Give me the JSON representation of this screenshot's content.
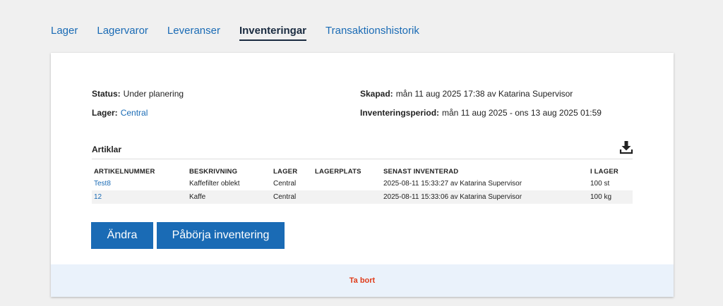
{
  "tabs": [
    {
      "label": "Lager"
    },
    {
      "label": "Lagervaror"
    },
    {
      "label": "Leveranser"
    },
    {
      "label": "Inventeringar"
    },
    {
      "label": "Transaktionshistorik"
    }
  ],
  "meta": {
    "status_label": "Status:",
    "status_value": "Under planering",
    "lager_label": "Lager:",
    "lager_value": "Central",
    "skapad_label": "Skapad:",
    "skapad_value": "mån 11 aug 2025 17:38 av Katarina Supervisor",
    "period_label": "Inventeringsperiod:",
    "period_value": "mån 11 aug 2025 - ons 13 aug 2025 01:59"
  },
  "articles": {
    "title": "Artiklar",
    "headers": [
      "ARTIKELNUMMER",
      "BESKRIVNING",
      "LAGER",
      "LAGERPLATS",
      "SENAST INVENTERAD",
      "I LAGER"
    ],
    "rows": [
      {
        "nr": "Test8",
        "desc": "Kaffefilter oblekt",
        "lager": "Central",
        "plats": "",
        "senast": "2025-08-11 15:33:27 av Katarina Supervisor",
        "antal": "100 st"
      },
      {
        "nr": "12",
        "desc": "Kaffe",
        "lager": "Central",
        "plats": "",
        "senast": "2025-08-11 15:33:06 av Katarina Supervisor",
        "antal": "100 kg"
      }
    ]
  },
  "actions": {
    "edit_label": "Ändra",
    "start_label": "Påbörja inventering",
    "delete_label": "Ta bort"
  },
  "icons": {
    "download": "download-icon"
  },
  "colors": {
    "accent": "#1a6bb5",
    "danger": "#e03c1a",
    "footer_bg": "#eaf2fb"
  }
}
